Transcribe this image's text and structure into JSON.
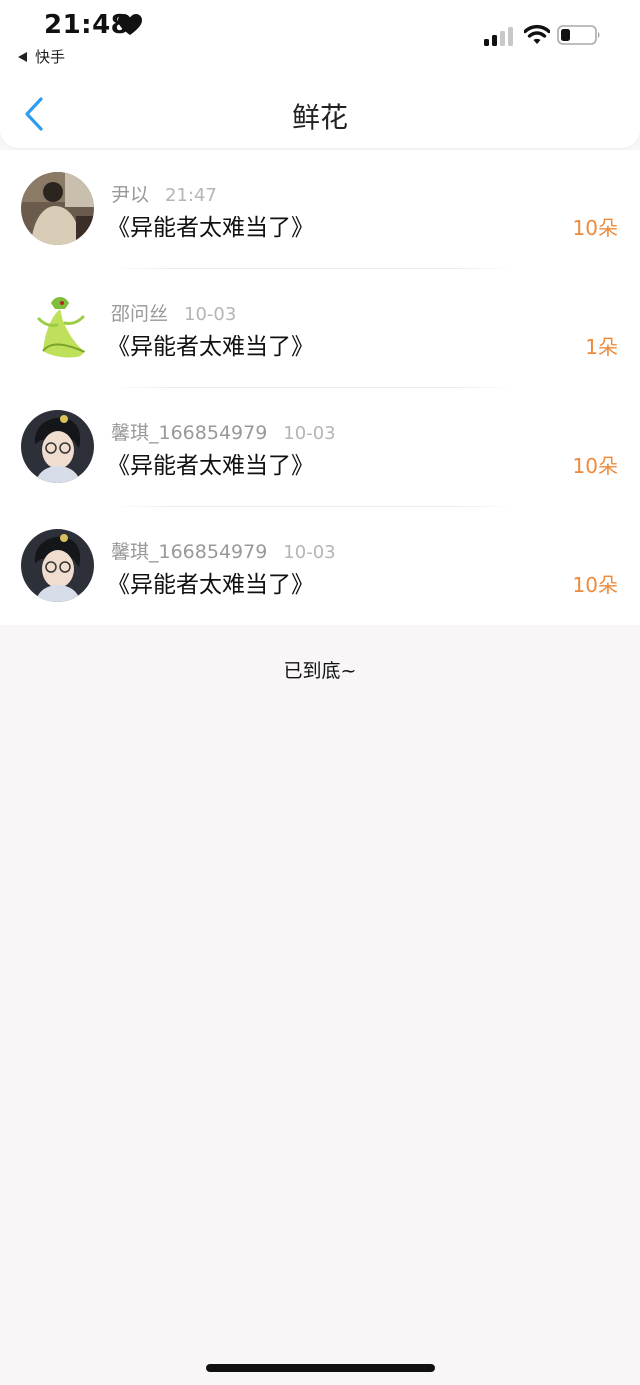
{
  "status_bar": {
    "time": "21:48",
    "back_app_label": "快手"
  },
  "nav": {
    "title": "鲜花"
  },
  "list": {
    "items": [
      {
        "name": "尹以",
        "time": "21:47",
        "title": "《异能者太难当了》",
        "count": "10朵"
      },
      {
        "name": "邵问丝",
        "time": "10-03",
        "title": "《异能者太难当了》",
        "count": "1朵"
      },
      {
        "name": "馨琪_166854979",
        "time": "10-03",
        "title": "《异能者太难当了》",
        "count": "10朵"
      },
      {
        "name": "馨琪_166854979",
        "time": "10-03",
        "title": "《异能者太难当了》",
        "count": "10朵"
      }
    ]
  },
  "footer": {
    "end_text": "已到底~"
  },
  "colors": {
    "accent_blue": "#2e9cf0",
    "count_orange": "#ee8a3c",
    "page_background": "#f8f6f7"
  }
}
